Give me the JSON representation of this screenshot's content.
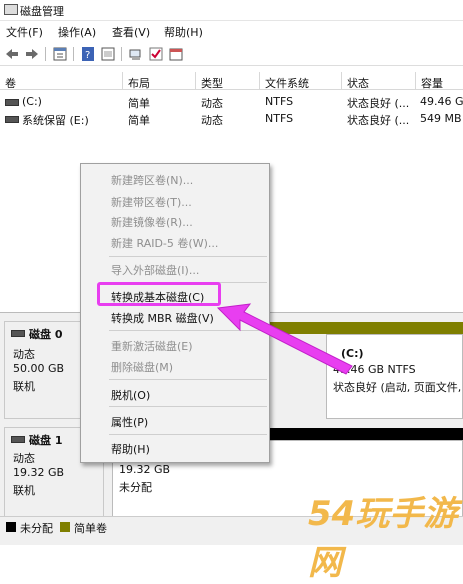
{
  "window": {
    "title": "磁盘管理"
  },
  "menu": [
    "文件(F)",
    "操作(A)",
    "查看(V)",
    "帮助(H)"
  ],
  "toolbar": {
    "icons": [
      "back-arrow-icon",
      "forward-arrow-icon",
      "properties-icon",
      "help-icon",
      "console-icon",
      "connect-icon",
      "check-icon",
      "calendar-icon"
    ]
  },
  "volumes": {
    "headers": [
      "卷",
      "布局",
      "类型",
      "文件系统",
      "状态",
      "容量"
    ],
    "rows": [
      {
        "volume": "(C:)",
        "layout": "简单",
        "type": "动态",
        "fs": "NTFS",
        "status": "状态良好 (...",
        "capacity": "49.46 GB"
      },
      {
        "volume": "系统保留 (E:)",
        "layout": "简单",
        "type": "动态",
        "fs": "NTFS",
        "status": "状态良好 (...",
        "capacity": "549 MB"
      }
    ]
  },
  "disks": [
    {
      "name": "磁盘 0",
      "type": "动态",
      "size": "50.00 GB",
      "state": "联机",
      "partition": {
        "name": "(C:)",
        "size": "49.46 GB NTFS",
        "status": "状态良好 (启动, 页面文件,"
      }
    },
    {
      "name": "磁盘 1",
      "type": "动态",
      "size": "19.32 GB",
      "state": "联机",
      "partition": {
        "size": "19.32 GB",
        "status": "未分配"
      }
    }
  ],
  "legend": [
    "未分配",
    "简单卷"
  ],
  "colors": {
    "unallocated": "#000000",
    "simple": "#7f7f00",
    "highlight": "#e83ef0"
  },
  "context_menu": [
    {
      "label": "新建跨区卷(N)...",
      "disabled": true
    },
    {
      "label": "新建带区卷(T)...",
      "disabled": true
    },
    {
      "label": "新建镜像卷(R)...",
      "disabled": true
    },
    {
      "label": "新建 RAID-5 卷(W)...",
      "disabled": true
    },
    {
      "label": "导入外部磁盘(I)...",
      "disabled": true
    },
    {
      "label": "转换成基本磁盘(C)",
      "disabled": false
    },
    {
      "label": "转换成 MBR 磁盘(V)",
      "disabled": false
    },
    {
      "label": "重新激活磁盘(E)",
      "disabled": true
    },
    {
      "label": "删除磁盘(M)",
      "disabled": true
    },
    {
      "label": "脱机(O)",
      "disabled": false
    },
    {
      "label": "属性(P)",
      "disabled": false
    },
    {
      "label": "帮助(H)",
      "disabled": false
    }
  ],
  "watermark": "54玩手游网"
}
